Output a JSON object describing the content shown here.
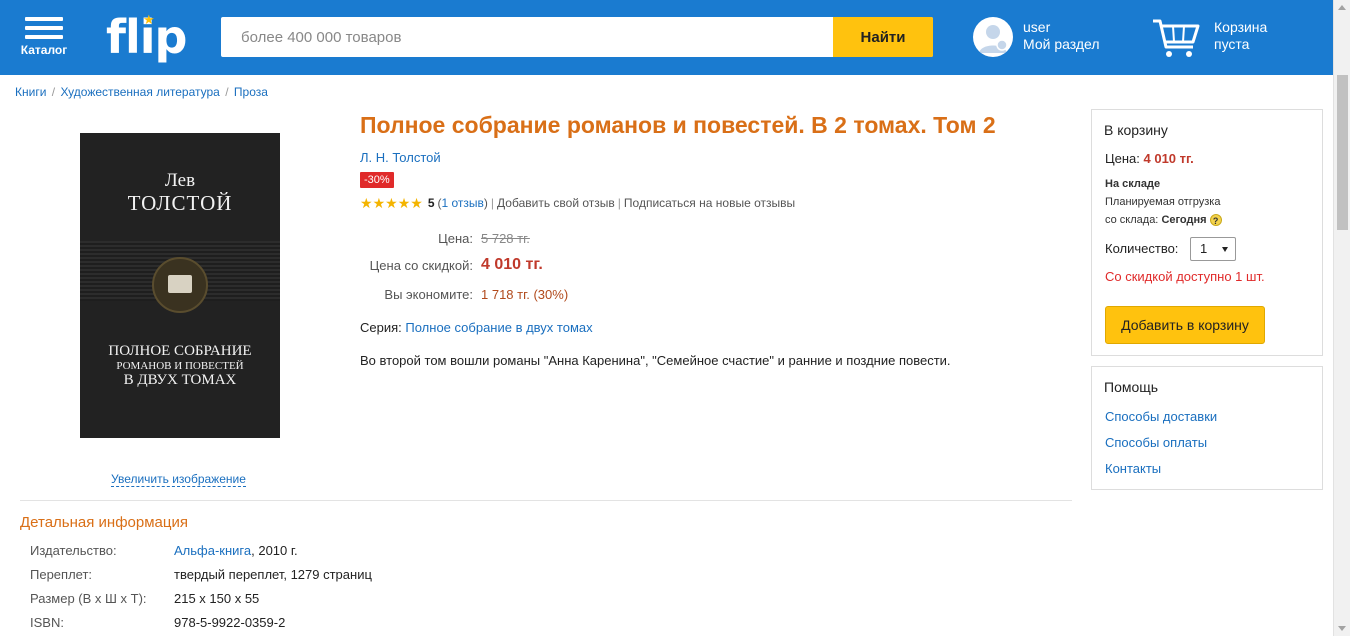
{
  "header": {
    "catalog_label": "Каталог",
    "logo_text": "flip",
    "search_placeholder": "более 400 000 товаров",
    "search_button": "Найти",
    "user_name": "user",
    "user_section": "Мой раздел",
    "cart_title": "Корзина",
    "cart_status": "пуста",
    "brand_color": "#1a7bd0",
    "accent_color": "#ffc20e"
  },
  "breadcrumb": [
    {
      "label": "Книги"
    },
    {
      "label": "Художественная литература"
    },
    {
      "label": "Проза"
    }
  ],
  "cover": {
    "author_first": "Лев",
    "author_last": "ТОЛСТОЙ",
    "title_line1": "ПОЛНОЕ СОБРАНИЕ",
    "title_line2": "РОМАНОВ И ПОВЕСТЕЙ",
    "title_line3": "В ДВУХ ТОМАХ",
    "enlarge_link": "Увеличить изображение"
  },
  "product": {
    "title": "Полное собрание романов и повестей. В 2 томах. Том 2",
    "author": "Л. Н. Толстой",
    "discount_badge": "-30%",
    "rating_value": "5",
    "reviews_link": "1 отзыв",
    "add_review": "Добавить свой отзыв",
    "subscribe_reviews": "Подписаться на новые отзывы",
    "price_label": "Цена:",
    "old_price": "5 728 тг.",
    "discount_price_label": "Цена со скидкой:",
    "discount_price": "4 010 тг.",
    "economy_label": "Вы экономите:",
    "economy_value": "1 718 тг. (30%)",
    "series_label": "Серия:",
    "series_value": "Полное собрание в двух томах",
    "description": "Во второй том вошли романы \"Анна Каренина\", \"Семейное счастие\" и ранние и поздние повести."
  },
  "details": {
    "heading": "Детальная информация",
    "rows": [
      {
        "label": "Издательство:",
        "link": "Альфа-книга",
        "value": ", 2010 г."
      },
      {
        "label": "Переплет:",
        "value": "твердый переплет, 1279 страниц"
      },
      {
        "label": "Размер (В х Ш х Т):",
        "value": "215 x 150 x 55"
      },
      {
        "label": "ISBN:",
        "value": "978-5-9922-0359-2"
      }
    ]
  },
  "cart_box": {
    "title": "В корзину",
    "price_label": "Цена:",
    "price_value": "4 010 тг.",
    "stock_status": "На складе",
    "shipping_line1": "Планируемая отгрузка",
    "shipping_line2": "со склада:",
    "shipping_day": "Сегодня",
    "qty_label": "Количество:",
    "qty_value": "1",
    "discount_note": "Со скидкой доступно 1 шт.",
    "add_button": "Добавить в корзину"
  },
  "help_box": {
    "title": "Помощь",
    "links": [
      "Способы доставки",
      "Способы оплаты",
      "Контакты"
    ]
  }
}
